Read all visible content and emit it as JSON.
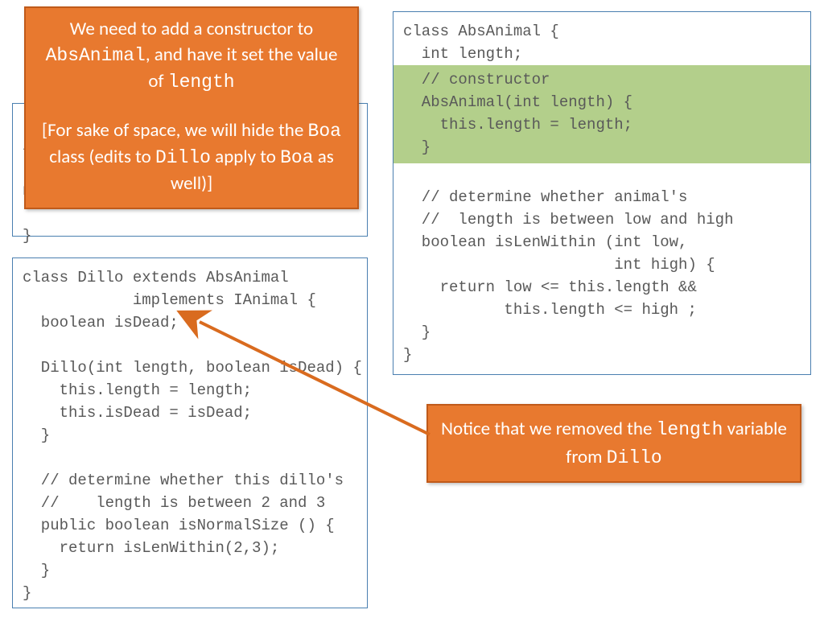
{
  "callout_top": {
    "line1_pre": "We need to add a constructor to ",
    "line1_code": "AbsAnimal",
    "line1_mid": ", and have it set the value of ",
    "line1_code2": "length",
    "line2_pre": "[For sake of space, we will hide the ",
    "line2_code": "Boa",
    "line2_mid": " class (edits to ",
    "line2_code2": "Dillo",
    "line2_post": " apply to ",
    "line2_code3": "Boa",
    "line2_end": " as well)]"
  },
  "hidden_box": {
    "l1": "i",
    "l2": "n",
    "l3": "}"
  },
  "abs_code": {
    "head": "class AbsAnimal {\n  int length;\n",
    "ctor": "  // constructor\n  AbsAnimal(int length) {\n    this.length = length;\n  }",
    "tail": "\n  // determine whether animal's\n  //  length is between low and high\n  boolean isLenWithin (int low,\n                       int high) {\n    return low <= this.length &&\n           this.length <= high ;\n  }\n}"
  },
  "dillo_code": "class Dillo extends AbsAnimal\n            implements IAnimal {\n  boolean isDead;\n\n  Dillo(int length, boolean isDead) {\n    this.length = length;\n    this.isDead = isDead;\n  }\n\n  // determine whether this dillo's\n  //    length is between 2 and 3\n  public boolean isNormalSize () {\n    return isLenWithin(2,3);\n  }\n}",
  "callout_right": {
    "pre": "Notice that we removed the ",
    "code1": "length",
    "mid": " variable from ",
    "code2": "Dillo"
  }
}
